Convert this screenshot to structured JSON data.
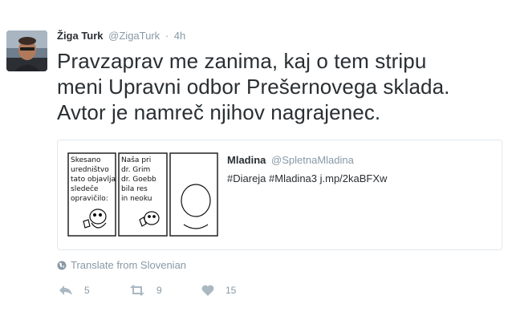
{
  "tweet": {
    "author_name": "Žiga Turk",
    "author_handle": "@ZigaTurk",
    "separator": "·",
    "time": "4h",
    "lines": [
      "Pravzaprav me zanima, kaj o tem stripu",
      "meni Upravni odbor Prešernovega sklada.",
      "Avtor je namreč njihov nagrajenec."
    ]
  },
  "quote": {
    "author_name": "Mladina",
    "author_handle": "@SpletnaMladina",
    "text": "#Diareja #Mladina3 j.mp/2kaBFXw",
    "comic_panel_1": [
      "Skesano",
      "uredništvo",
      "tato objavlja",
      "sledeče",
      "opravičilo:"
    ],
    "comic_panel_2": [
      "Naša pri",
      "dr. Grim",
      "dr. Goebb",
      "bila res",
      "in neoku"
    ]
  },
  "translate": {
    "label": "Translate from Slovenian",
    "icon": "globe-icon"
  },
  "actions": {
    "reply_icon": "reply-icon",
    "reply_count": "5",
    "retweet_icon": "retweet-icon",
    "retweet_count": "9",
    "like_icon": "heart-icon",
    "like_count": "15"
  },
  "colors": {
    "text": "#292f33",
    "muted": "#8899a6",
    "icon": "#aab8c2",
    "border": "#e1e8ed"
  }
}
